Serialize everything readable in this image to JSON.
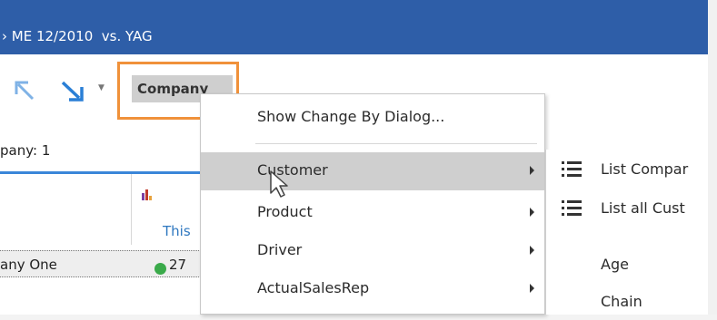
{
  "title_bar": {
    "text": "› ME 12/2010  vs. YAG"
  },
  "toolbar": {
    "company_label": "Company"
  },
  "grid": {
    "company_count": "pany: 1",
    "column_header": "This",
    "row_name": "any One",
    "row_value": "27"
  },
  "context_menu": {
    "header_item": "Show Change By Dialog...",
    "items": [
      {
        "label": "Customer",
        "has_submenu": true,
        "active": true
      },
      {
        "label": "Product",
        "has_submenu": true
      },
      {
        "label": "Driver",
        "has_submenu": true
      },
      {
        "label": "ActualSalesRep",
        "has_submenu": true
      }
    ]
  },
  "submenu": {
    "items": [
      {
        "label": "List Compar",
        "icon": "list-icon"
      },
      {
        "label": "List all Cust",
        "icon": "list-icon"
      },
      {
        "label": "Age"
      },
      {
        "label": "Chain"
      }
    ]
  },
  "colors": {
    "title_bar": "#2e5ea8",
    "highlight": "#f0913a",
    "accent": "#3a86d9",
    "active_item": "#cfcfcf",
    "status_green": "#3aaa4a"
  }
}
